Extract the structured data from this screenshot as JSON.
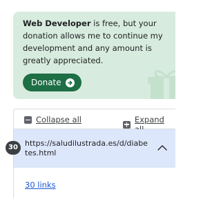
{
  "donation": {
    "brand": "Web Developer",
    "message": " is free, but your donation allows me to continue my development and any amount is greatly appreciated.",
    "button_label": "Donate",
    "button_icon": "arrow-right-circle-icon",
    "card_color": "#d7ecde",
    "button_color": "#1e6e46"
  },
  "toolbar": {
    "collapse_label": "Collapse all",
    "collapse_icon": "minus-square-icon",
    "expand_label": "Expand all",
    "expand_icon": "plus-square-icon"
  },
  "pages": [
    {
      "count": "30",
      "url": "https://saludilustrada.es/d/diabetes.html",
      "expanded": true,
      "toggle_icon": "chevron-up-icon",
      "links_label": "30 links"
    }
  ]
}
